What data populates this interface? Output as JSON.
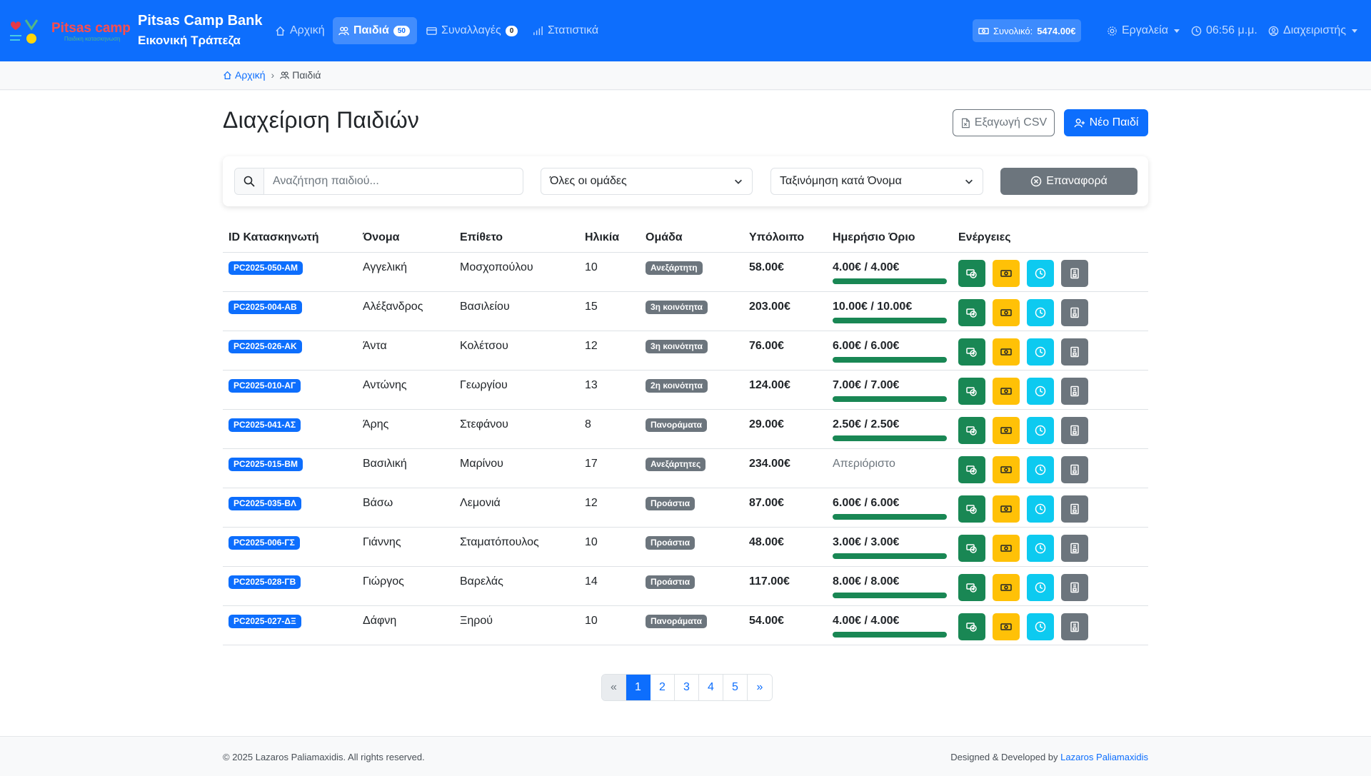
{
  "app": {
    "logo_text": "Pitsas camp",
    "logo_tagline": "Παιδικη κατασκηνωση",
    "brand_line1": "Pitsas Camp Bank",
    "brand_line2": "Εικονική Τράπεζα",
    "primary_color": "#0d6efd"
  },
  "nav": {
    "home": "Αρχική",
    "children": "Παιδιά",
    "children_count": "50",
    "transactions": "Συναλλαγές",
    "transactions_count": "0",
    "stats": "Στατιστικά",
    "total_label": "Συνολικό:",
    "total_value": "5474.00€",
    "tools": "Εργαλεία",
    "time": "06:56 μ.μ.",
    "user": "Διαχειριστής"
  },
  "breadcrumb": {
    "home": "Αρχική",
    "current": "Παιδιά"
  },
  "page": {
    "title": "Διαχείριση Παιδιών",
    "export_label": "Εξαγωγή CSV",
    "new_label": "Νέο Παιδί"
  },
  "filters": {
    "search_placeholder": "Αναζήτηση παιδιού...",
    "group_select": "Όλες οι ομάδες",
    "sort_select": "Ταξινόμηση κατά Όνομα",
    "reset_label": "Επαναφορά"
  },
  "table": {
    "headers": [
      "ID Κατασκηνωτή",
      "Όνομα",
      "Επίθετο",
      "Ηλικία",
      "Ομάδα",
      "Υπόλοιπο",
      "Ημερήσιο Όριο",
      "Ενέργειες"
    ],
    "rows": [
      {
        "id": "PC2025-050-AM",
        "first": "Αγγελική",
        "last": "Μοσχοπούλου",
        "age": "10",
        "team": "Ανεξάρτητη",
        "balance": "58.00€",
        "limit": "4.00€ / 4.00€",
        "progress": 1.0
      },
      {
        "id": "PC2025-004-AB",
        "first": "Αλέξανδρος",
        "last": "Βασιλείου",
        "age": "15",
        "team": "3η κοινότητα",
        "balance": "203.00€",
        "limit": "10.00€ / 10.00€",
        "progress": 1.0
      },
      {
        "id": "PC2025-026-AK",
        "first": "Άντα",
        "last": "Κολέτσου",
        "age": "12",
        "team": "3η κοινότητα",
        "balance": "76.00€",
        "limit": "6.00€ / 6.00€",
        "progress": 1.0
      },
      {
        "id": "PC2025-010-ΑΓ",
        "first": "Αντώνης",
        "last": "Γεωργίου",
        "age": "13",
        "team": "2η κοινότητα",
        "balance": "124.00€",
        "limit": "7.00€ / 7.00€",
        "progress": 1.0
      },
      {
        "id": "PC2025-041-ΑΣ",
        "first": "Άρης",
        "last": "Στεφάνου",
        "age": "8",
        "team": "Πανοράματα",
        "balance": "29.00€",
        "limit": "2.50€ / 2.50€",
        "progress": 1.0
      },
      {
        "id": "PC2025-015-BM",
        "first": "Βασιλική",
        "last": "Μαρίνου",
        "age": "17",
        "team": "Ανεξάρτητες",
        "balance": "234.00€",
        "limit": "Απεριόριστο",
        "progress": null
      },
      {
        "id": "PC2025-035-BΛ",
        "first": "Βάσω",
        "last": "Λεμονιά",
        "age": "12",
        "team": "Προάστια",
        "balance": "87.00€",
        "limit": "6.00€ / 6.00€",
        "progress": 1.0
      },
      {
        "id": "PC2025-006-ΓΣ",
        "first": "Γιάννης",
        "last": "Σταματόπουλος",
        "age": "10",
        "team": "Προάστια",
        "balance": "48.00€",
        "limit": "3.00€ / 3.00€",
        "progress": 1.0
      },
      {
        "id": "PC2025-028-ΓΒ",
        "first": "Γιώργος",
        "last": "Βαρελάς",
        "age": "14",
        "team": "Προάστια",
        "balance": "117.00€",
        "limit": "8.00€ / 8.00€",
        "progress": 1.0
      },
      {
        "id": "PC2025-027-ΔΞ",
        "first": "Δάφνη",
        "last": "Ξηρού",
        "age": "10",
        "team": "Πανοράματα",
        "balance": "54.00€",
        "limit": "4.00€ / 4.00€",
        "progress": 1.0
      }
    ]
  },
  "pagination": {
    "prev": "«",
    "pages": [
      "1",
      "2",
      "3",
      "4",
      "5"
    ],
    "current": "1",
    "next": "»"
  },
  "footer": {
    "copyright": "© 2025 Lazaros Paliamaxidis. All rights reserved.",
    "designed_prefix": "Designed & Developed by",
    "designed_name": "Lazaros Paliamaxidis"
  }
}
